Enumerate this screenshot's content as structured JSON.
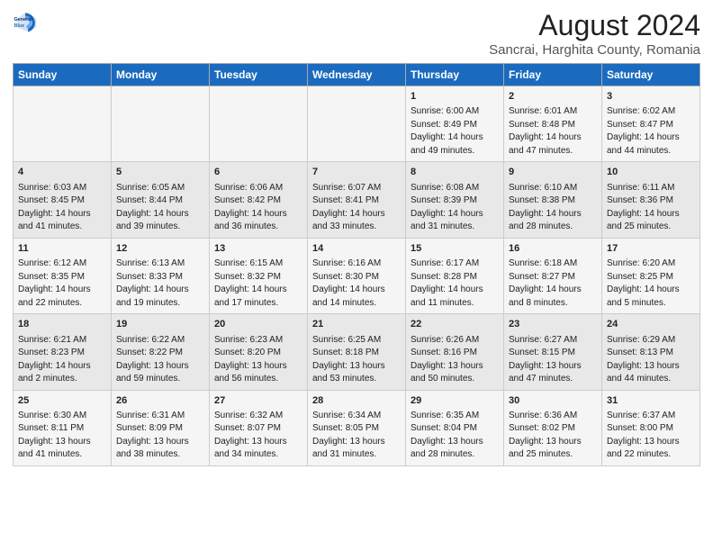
{
  "logo": {
    "line1": "General",
    "line2": "Blue"
  },
  "title": "August 2024",
  "subtitle": "Sancrai, Harghita County, Romania",
  "weekdays": [
    "Sunday",
    "Monday",
    "Tuesday",
    "Wednesday",
    "Thursday",
    "Friday",
    "Saturday"
  ],
  "weeks": [
    [
      {
        "day": "",
        "info": ""
      },
      {
        "day": "",
        "info": ""
      },
      {
        "day": "",
        "info": ""
      },
      {
        "day": "",
        "info": ""
      },
      {
        "day": "1",
        "info": "Sunrise: 6:00 AM\nSunset: 8:49 PM\nDaylight: 14 hours and 49 minutes."
      },
      {
        "day": "2",
        "info": "Sunrise: 6:01 AM\nSunset: 8:48 PM\nDaylight: 14 hours and 47 minutes."
      },
      {
        "day": "3",
        "info": "Sunrise: 6:02 AM\nSunset: 8:47 PM\nDaylight: 14 hours and 44 minutes."
      }
    ],
    [
      {
        "day": "4",
        "info": "Sunrise: 6:03 AM\nSunset: 8:45 PM\nDaylight: 14 hours and 41 minutes."
      },
      {
        "day": "5",
        "info": "Sunrise: 6:05 AM\nSunset: 8:44 PM\nDaylight: 14 hours and 39 minutes."
      },
      {
        "day": "6",
        "info": "Sunrise: 6:06 AM\nSunset: 8:42 PM\nDaylight: 14 hours and 36 minutes."
      },
      {
        "day": "7",
        "info": "Sunrise: 6:07 AM\nSunset: 8:41 PM\nDaylight: 14 hours and 33 minutes."
      },
      {
        "day": "8",
        "info": "Sunrise: 6:08 AM\nSunset: 8:39 PM\nDaylight: 14 hours and 31 minutes."
      },
      {
        "day": "9",
        "info": "Sunrise: 6:10 AM\nSunset: 8:38 PM\nDaylight: 14 hours and 28 minutes."
      },
      {
        "day": "10",
        "info": "Sunrise: 6:11 AM\nSunset: 8:36 PM\nDaylight: 14 hours and 25 minutes."
      }
    ],
    [
      {
        "day": "11",
        "info": "Sunrise: 6:12 AM\nSunset: 8:35 PM\nDaylight: 14 hours and 22 minutes."
      },
      {
        "day": "12",
        "info": "Sunrise: 6:13 AM\nSunset: 8:33 PM\nDaylight: 14 hours and 19 minutes."
      },
      {
        "day": "13",
        "info": "Sunrise: 6:15 AM\nSunset: 8:32 PM\nDaylight: 14 hours and 17 minutes."
      },
      {
        "day": "14",
        "info": "Sunrise: 6:16 AM\nSunset: 8:30 PM\nDaylight: 14 hours and 14 minutes."
      },
      {
        "day": "15",
        "info": "Sunrise: 6:17 AM\nSunset: 8:28 PM\nDaylight: 14 hours and 11 minutes."
      },
      {
        "day": "16",
        "info": "Sunrise: 6:18 AM\nSunset: 8:27 PM\nDaylight: 14 hours and 8 minutes."
      },
      {
        "day": "17",
        "info": "Sunrise: 6:20 AM\nSunset: 8:25 PM\nDaylight: 14 hours and 5 minutes."
      }
    ],
    [
      {
        "day": "18",
        "info": "Sunrise: 6:21 AM\nSunset: 8:23 PM\nDaylight: 14 hours and 2 minutes."
      },
      {
        "day": "19",
        "info": "Sunrise: 6:22 AM\nSunset: 8:22 PM\nDaylight: 13 hours and 59 minutes."
      },
      {
        "day": "20",
        "info": "Sunrise: 6:23 AM\nSunset: 8:20 PM\nDaylight: 13 hours and 56 minutes."
      },
      {
        "day": "21",
        "info": "Sunrise: 6:25 AM\nSunset: 8:18 PM\nDaylight: 13 hours and 53 minutes."
      },
      {
        "day": "22",
        "info": "Sunrise: 6:26 AM\nSunset: 8:16 PM\nDaylight: 13 hours and 50 minutes."
      },
      {
        "day": "23",
        "info": "Sunrise: 6:27 AM\nSunset: 8:15 PM\nDaylight: 13 hours and 47 minutes."
      },
      {
        "day": "24",
        "info": "Sunrise: 6:29 AM\nSunset: 8:13 PM\nDaylight: 13 hours and 44 minutes."
      }
    ],
    [
      {
        "day": "25",
        "info": "Sunrise: 6:30 AM\nSunset: 8:11 PM\nDaylight: 13 hours and 41 minutes."
      },
      {
        "day": "26",
        "info": "Sunrise: 6:31 AM\nSunset: 8:09 PM\nDaylight: 13 hours and 38 minutes."
      },
      {
        "day": "27",
        "info": "Sunrise: 6:32 AM\nSunset: 8:07 PM\nDaylight: 13 hours and 34 minutes."
      },
      {
        "day": "28",
        "info": "Sunrise: 6:34 AM\nSunset: 8:05 PM\nDaylight: 13 hours and 31 minutes."
      },
      {
        "day": "29",
        "info": "Sunrise: 6:35 AM\nSunset: 8:04 PM\nDaylight: 13 hours and 28 minutes."
      },
      {
        "day": "30",
        "info": "Sunrise: 6:36 AM\nSunset: 8:02 PM\nDaylight: 13 hours and 25 minutes."
      },
      {
        "day": "31",
        "info": "Sunrise: 6:37 AM\nSunset: 8:00 PM\nDaylight: 13 hours and 22 minutes."
      }
    ]
  ]
}
